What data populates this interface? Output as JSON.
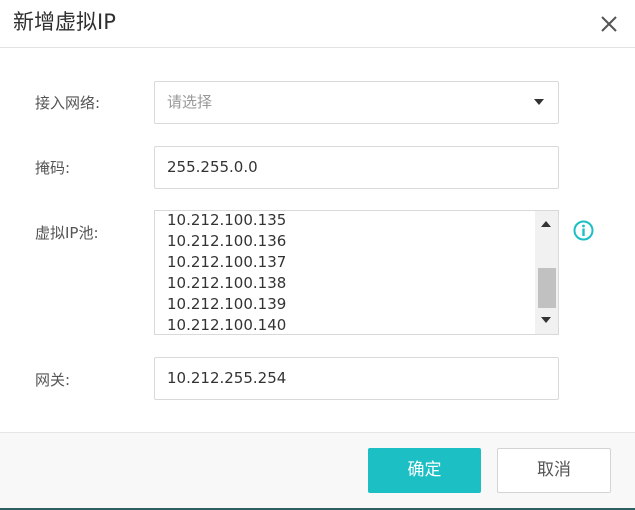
{
  "dialog": {
    "title": "新增虚拟IP",
    "close_icon": "close-icon"
  },
  "form": {
    "network": {
      "label": "接入网络:",
      "placeholder": "请选择",
      "icon": "chevron-down-icon"
    },
    "mask": {
      "label": "掩码:",
      "value": "255.255.0.0"
    },
    "ip_pool": {
      "label": "虚拟IP池:",
      "items": [
        "10.212.100.135",
        "10.212.100.136",
        "10.212.100.137",
        "10.212.100.138",
        "10.212.100.139",
        "10.212.100.140"
      ],
      "info_icon": "info-icon"
    },
    "gateway": {
      "label": "网关:",
      "value": "10.212.255.254"
    }
  },
  "footer": {
    "ok_label": "确定",
    "cancel_label": "取消"
  },
  "colors": {
    "accent": "#1bbfc4",
    "info": "#1bbfc4"
  }
}
